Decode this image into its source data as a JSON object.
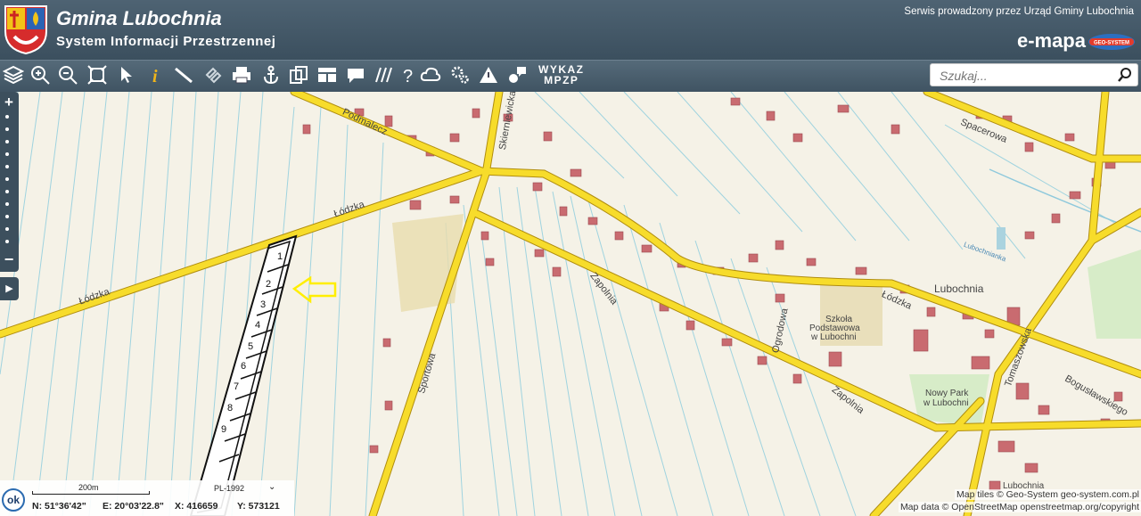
{
  "header": {
    "title": "Gmina Lubochnia",
    "subtitle": "System Informacji Przestrzennej",
    "served_by": "Serwis prowadzony przez Urząd Gminy Lubochnia",
    "brand": "e-mapa",
    "brand_logo_text": "GEO-SYSTEM"
  },
  "toolbar": {
    "tools": [
      "layers-icon",
      "zoom-in-icon",
      "zoom-out-icon",
      "zoom-extent-icon",
      "select-pointer-icon",
      "info-icon",
      "measure-ruler-icon",
      "link-icon",
      "print-icon",
      "anchor-icon",
      "copy-icon",
      "layout-icon",
      "speech-bubble-icon",
      "hatch-icon",
      "help-icon",
      "cloud-icon",
      "settings-icon",
      "warning-icon",
      "comment-icon"
    ],
    "wykaz_line1": "WYKAZ",
    "wykaz_line2": "MPZP"
  },
  "search": {
    "placeholder": "Szukaj..."
  },
  "map": {
    "streets": {
      "podmalecz": "Podmalecz",
      "skierniewicka": "Skierniewicka",
      "lodzka_west": "Łódzka",
      "lodzka_mid": "Łódzka",
      "lodzka_east": "Łódzka",
      "spacerowa": "Spacerowa",
      "zapolnia_1": "Zapolnia",
      "zapolnia_2": "Zapolnia",
      "sportowa": "Sportowa",
      "ogrodowa": "Ogrodowa",
      "tomaszowska": "Tomaszowska",
      "boguslawskiego": "Bogusławskiego",
      "lubochnianka": "Lubochnianka"
    },
    "places": {
      "town": "Lubochnia",
      "school_1": "Szkoła",
      "school_2": "Podstawowa",
      "school_3": "w Lubochni",
      "park_1": "Nowy Park",
      "park_2": "w Lubochni",
      "town_south": "Lubochnia"
    },
    "plots": [
      "1",
      "2",
      "3",
      "4",
      "5",
      "6",
      "7",
      "8",
      "9"
    ]
  },
  "footer": {
    "ok_label": "ok",
    "scale_label": "200m",
    "crs": "PL-1992",
    "north": "N: 51°36'42\"",
    "east": "E: 20°03'22.8\"",
    "x": "X: 416659",
    "y": "Y: 573121",
    "attribution_tiles": "Map tiles © Geo-System geo-system.com.pl",
    "attribution_data": "Map data © OpenStreetMap openstreetmap.org/copyright"
  },
  "colors": {
    "road": "#f7dc2b",
    "road_edge": "#a88c10",
    "building": "#c86a6e",
    "header": "#4a5e6e"
  }
}
